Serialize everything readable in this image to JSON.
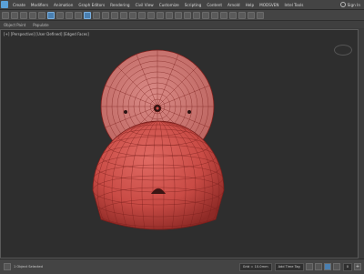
{
  "menubar": {
    "items": [
      "Create",
      "Modifiers",
      "Animation",
      "Graph Editors",
      "Rendering",
      "Civil View",
      "Customize",
      "Scripting",
      "Content",
      "Arnold",
      "Help",
      "MODSVEN",
      "Intel Tools"
    ],
    "right_label": "Sign In"
  },
  "ribbon": {
    "tabs": [
      "Object Paint",
      "Populate"
    ]
  },
  "viewport": {
    "label": "[+] [Perspective] [User Defined] [Edged Faces]"
  },
  "statusbar": {
    "left_label": "1 Object Selected",
    "grid_label": "Grid = 10.0mm",
    "key_label": "Add Time Tag",
    "frame_value": "0",
    "plus_icon": "+"
  },
  "colors": {
    "mesh_fill": "#c94b45",
    "mesh_wire": "#7a1f1c",
    "viewport_bg": "#2e2e2e",
    "accent": "#4a7fb0"
  }
}
